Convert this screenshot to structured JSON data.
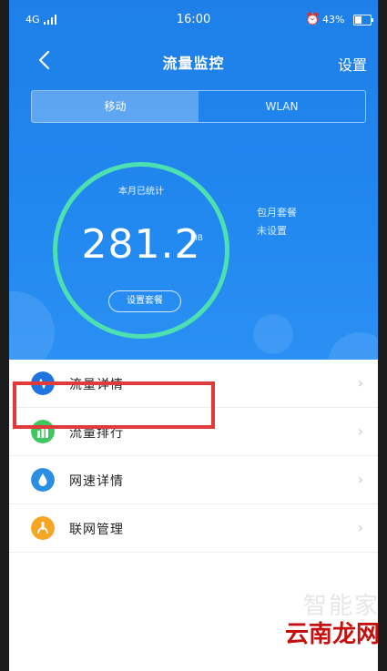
{
  "status_bar": {
    "network": "4G",
    "time": "16:00",
    "alarm_icon": "⏰",
    "battery_text": "43%",
    "battery_level": 0.43
  },
  "header": {
    "back_icon": "chevron-left-icon",
    "title": "流量监控",
    "settings_label": "设置"
  },
  "tabs": [
    {
      "label": "移动",
      "active": true
    },
    {
      "label": "WLAN",
      "active": false
    }
  ],
  "usage": {
    "caption": "本月已统计",
    "value": "281.2",
    "unit": "MB",
    "button_label": "设置套餐"
  },
  "plan": {
    "line1": "包月套餐",
    "line2": "未设置"
  },
  "list": [
    {
      "label": "流量详情",
      "icon": "wave-chart-icon",
      "color": "#1f74e0"
    },
    {
      "label": "流量排行",
      "icon": "ranking-bars-icon",
      "color": "#3fc860"
    },
    {
      "label": "网速详情",
      "icon": "speed-drop-icon",
      "color": "#2a8fe3"
    },
    {
      "label": "联网管理",
      "icon": "network-manage-icon",
      "color": "#f6a623"
    }
  ],
  "chevron_glyph": "›",
  "watermark": {
    "line1": "智能家",
    "line2": "云南龙网"
  },
  "colors": {
    "header_blue": "#1e7fe8",
    "gauge_ring": "#4de0b0",
    "highlight_box": "#e03a3a"
  }
}
